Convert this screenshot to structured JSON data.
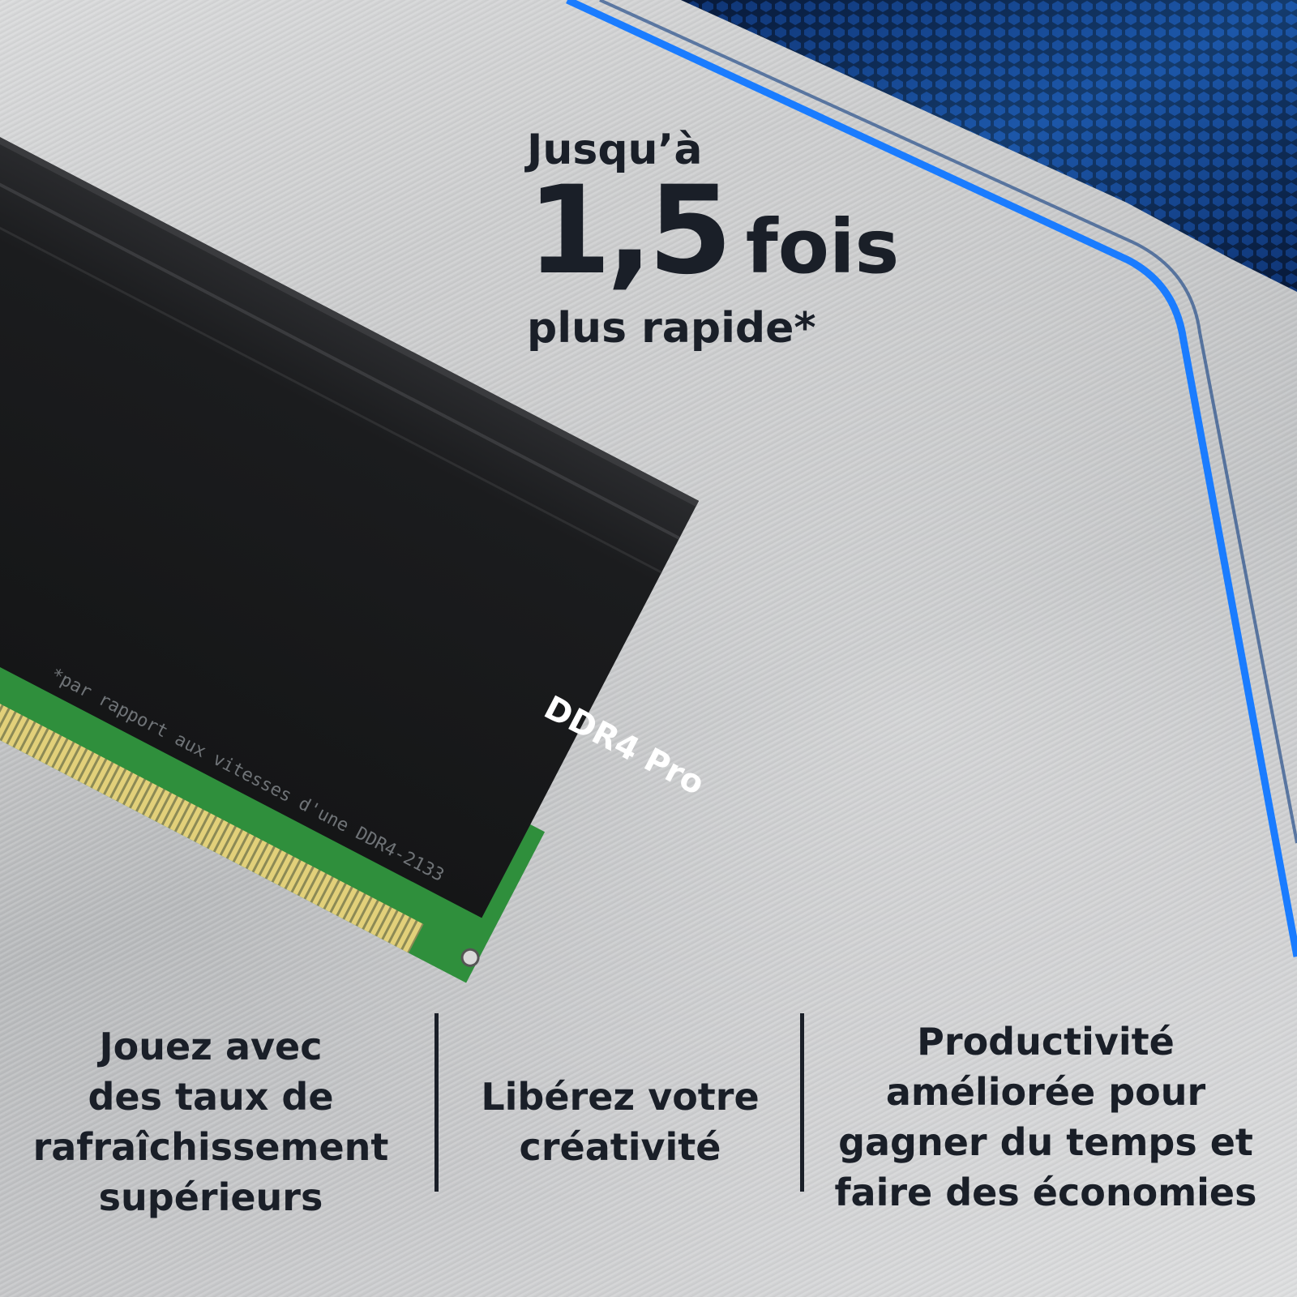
{
  "headline": {
    "prefix": "Jusqu’à",
    "value": "1,5",
    "unit": "fois",
    "suffix": "plus rapide*"
  },
  "product": {
    "label": "DDR4 Pro"
  },
  "footnote": "*par rapport aux vitesses d'une DDR4-2133",
  "features": [
    {
      "lines": [
        "Jouez avec",
        "des taux de",
        "rafraîchissement",
        "supérieurs"
      ]
    },
    {
      "lines": [
        "Libérez votre",
        "créativité"
      ]
    },
    {
      "lines": [
        "Productivité",
        "améliorée pour",
        "gagner du temps et",
        "faire des économies"
      ]
    }
  ],
  "colors": {
    "text": "#1a1f28",
    "accent_blue": "#1e90ff",
    "heatsink": "#1c1d1f",
    "pcb": "#2f8f3c",
    "contacts": "#d8c66a"
  }
}
